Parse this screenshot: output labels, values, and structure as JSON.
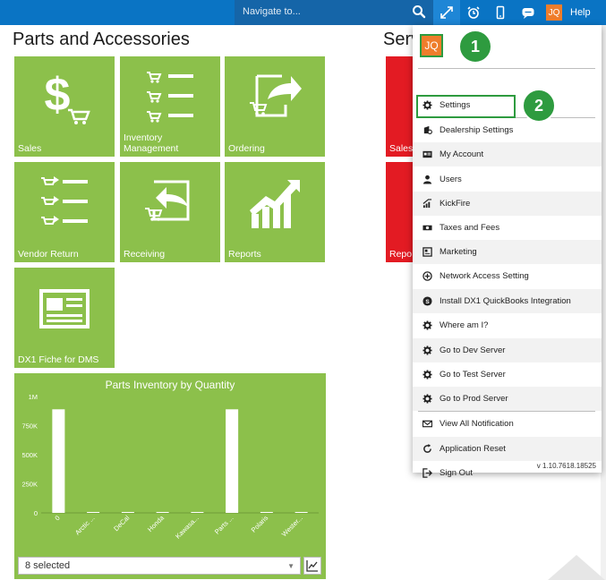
{
  "topbar": {
    "search_placeholder": "Navigate to...",
    "user_initials": "JQ",
    "help_label": "Help"
  },
  "page": {
    "title": "Parts and Accessories",
    "secondary_title_partial": "Serv"
  },
  "tiles": [
    {
      "label": "Sales",
      "icon": "dollar-cart-icon"
    },
    {
      "label": "Inventory\nManagement",
      "icon": "cart-list-icon"
    },
    {
      "label": "Ordering",
      "icon": "cart-export-icon"
    },
    {
      "label": "Vendor Return",
      "icon": "return-list-icon"
    },
    {
      "label": "Receiving",
      "icon": "receive-icon"
    },
    {
      "label": "Reports",
      "icon": "chart-up-icon"
    },
    {
      "label": "DX1 Fiche for DMS",
      "icon": "newspaper-icon"
    }
  ],
  "service_tiles": [
    {
      "label": "Sales"
    },
    {
      "label": "Repo"
    }
  ],
  "chart": {
    "title": "Parts Inventory by Quantity",
    "series_selector": "8 selected"
  },
  "chart_data": {
    "type": "bar",
    "title": "Parts Inventory by Quantity",
    "categories": [
      "0",
      "Arctic ...",
      "DeCal",
      "Honda",
      "Kawasa...",
      "Parts ...",
      "Polaris",
      "Wester..."
    ],
    "values": [
      890000,
      3000,
      1000,
      4000,
      2000,
      890000,
      2000,
      1500
    ],
    "y_ticks": [
      "0",
      "250K",
      "500K",
      "750K",
      "1M"
    ],
    "ylim": [
      0,
      1000000
    ],
    "grid": false,
    "bar_color": "#ffffff"
  },
  "menu": {
    "avatar_initials": "JQ",
    "items": [
      {
        "label": "Settings",
        "icon": "gear-icon"
      },
      {
        "label": "Dealership Settings",
        "icon": "dealership-settings-icon"
      },
      {
        "label": "My Account",
        "icon": "id-card-icon"
      },
      {
        "label": "Users",
        "icon": "user-icon"
      },
      {
        "label": "KickFire",
        "icon": "kickfire-icon"
      },
      {
        "label": "Taxes and Fees",
        "icon": "money-icon"
      },
      {
        "label": "Marketing",
        "icon": "newspaper-icon"
      },
      {
        "label": "Network Access Setting",
        "icon": "network-icon"
      },
      {
        "label": "Install DX1 QuickBooks Integration",
        "icon": "quickbooks-icon"
      },
      {
        "label": "Where am I?",
        "icon": "gear-icon"
      },
      {
        "label": "Go to Dev Server",
        "icon": "gear-icon"
      },
      {
        "label": "Go to Test Server",
        "icon": "gear-icon"
      },
      {
        "label": "Go to Prod Server",
        "icon": "gear-icon"
      },
      {
        "label": "View All Notification",
        "icon": "envelope-icon"
      },
      {
        "label": "Application Reset",
        "icon": "reset-icon"
      },
      {
        "label": "Sign Out",
        "icon": "sign-out-icon"
      }
    ],
    "version": "v 1.10.7618.18525"
  },
  "callouts": [
    "1",
    "2"
  ],
  "colors": {
    "topbar": "#0a74c4",
    "tile_green": "#8cc04b",
    "tile_red": "#e31b23",
    "callout_green": "#2e9b3f",
    "avatar_orange": "#ef7d2b"
  }
}
